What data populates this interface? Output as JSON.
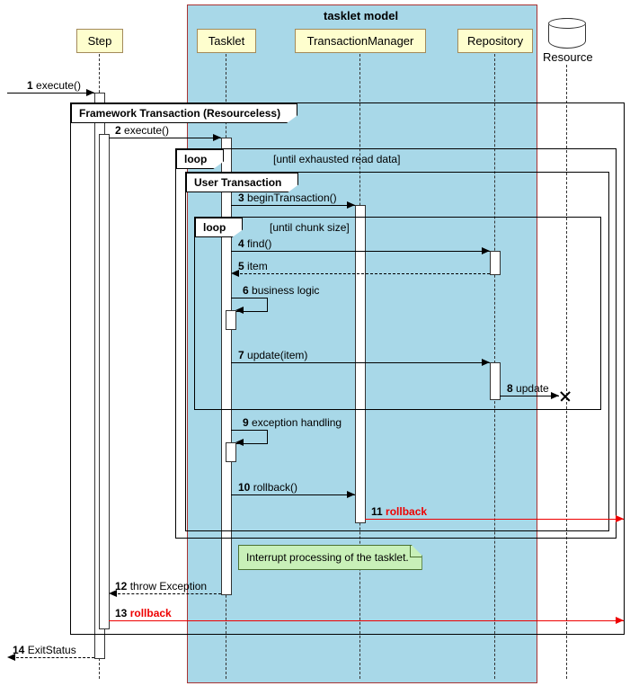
{
  "box_label": "tasklet model",
  "participants": {
    "step": "Step",
    "tasklet": "Tasklet",
    "tm": "TransactionManager",
    "repo": "Repository",
    "resource": "Resource"
  },
  "frames": {
    "fw": "Framework Transaction (Resourceless)",
    "loop1": "loop",
    "loop1_cond": "[until exhausted read data]",
    "user": "User Transaction",
    "loop2": "loop",
    "loop2_cond": "[until chunk size]"
  },
  "messages": {
    "m1": {
      "n": "1",
      "t": "execute()"
    },
    "m2": {
      "n": "2",
      "t": "execute()"
    },
    "m3": {
      "n": "3",
      "t": "beginTransaction()"
    },
    "m4": {
      "n": "4",
      "t": "find()"
    },
    "m5": {
      "n": "5",
      "t": "item"
    },
    "m6": {
      "n": "6",
      "t": "business logic"
    },
    "m7": {
      "n": "7",
      "t": "update(item)"
    },
    "m8": {
      "n": "8",
      "t": "update"
    },
    "m9": {
      "n": "9",
      "t": "exception handling"
    },
    "m10": {
      "n": "10",
      "t": "rollback()"
    },
    "m11": {
      "n": "11",
      "t": "rollback"
    },
    "m12": {
      "n": "12",
      "t": "throw Exception"
    },
    "m13": {
      "n": "13",
      "t": "rollback"
    },
    "m14": {
      "n": "14",
      "t": "ExitStatus"
    }
  },
  "note": "Interrupt processing of the tasklet.",
  "chart_data": {
    "type": "sequence_diagram",
    "participants": [
      "Step",
      "Tasklet",
      "TransactionManager",
      "Repository",
      "Resource"
    ],
    "group": "tasklet model",
    "group_members": [
      "Tasklet",
      "TransactionManager",
      "Repository"
    ],
    "messages": [
      {
        "n": 1,
        "from": "(caller)",
        "to": "Step",
        "label": "execute()",
        "kind": "sync"
      },
      {
        "frame": "Framework Transaction (Resourceless)",
        "children": [
          {
            "n": 2,
            "from": "Step",
            "to": "Tasklet",
            "label": "execute()",
            "kind": "sync"
          },
          {
            "frame": "loop",
            "guard": "[until exhausted read data]",
            "children": [
              {
                "frame": "User Transaction",
                "children": [
                  {
                    "n": 3,
                    "from": "Tasklet",
                    "to": "TransactionManager",
                    "label": "beginTransaction()",
                    "kind": "sync"
                  },
                  {
                    "frame": "loop",
                    "guard": "[until chunk size]",
                    "children": [
                      {
                        "n": 4,
                        "from": "Tasklet",
                        "to": "Repository",
                        "label": "find()",
                        "kind": "sync"
                      },
                      {
                        "n": 5,
                        "from": "Repository",
                        "to": "Tasklet",
                        "label": "item",
                        "kind": "return"
                      },
                      {
                        "n": 6,
                        "from": "Tasklet",
                        "to": "Tasklet",
                        "label": "business logic",
                        "kind": "self"
                      },
                      {
                        "n": 7,
                        "from": "Tasklet",
                        "to": "Repository",
                        "label": "update(item)",
                        "kind": "sync"
                      },
                      {
                        "n": 8,
                        "from": "Repository",
                        "to": "Resource",
                        "label": "update",
                        "kind": "sync",
                        "destroy": true
                      }
                    ]
                  },
                  {
                    "n": 9,
                    "from": "Tasklet",
                    "to": "Tasklet",
                    "label": "exception handling",
                    "kind": "self"
                  },
                  {
                    "n": 10,
                    "from": "Tasklet",
                    "to": "TransactionManager",
                    "label": "rollback()",
                    "kind": "sync"
                  },
                  {
                    "n": 11,
                    "from": "TransactionManager",
                    "to": "Resource",
                    "label": "rollback",
                    "kind": "sync",
                    "color": "red"
                  }
                ]
              }
            ]
          },
          {
            "note": "Interrupt processing of the tasklet.",
            "attached": "Tasklet"
          },
          {
            "n": 12,
            "from": "Tasklet",
            "to": "Step",
            "label": "throw Exception",
            "kind": "return"
          },
          {
            "n": 13,
            "from": "Step",
            "to": "Resource",
            "label": "rollback",
            "kind": "sync",
            "color": "red"
          }
        ]
      },
      {
        "n": 14,
        "from": "Step",
        "to": "(caller)",
        "label": "ExitStatus",
        "kind": "return"
      }
    ]
  }
}
